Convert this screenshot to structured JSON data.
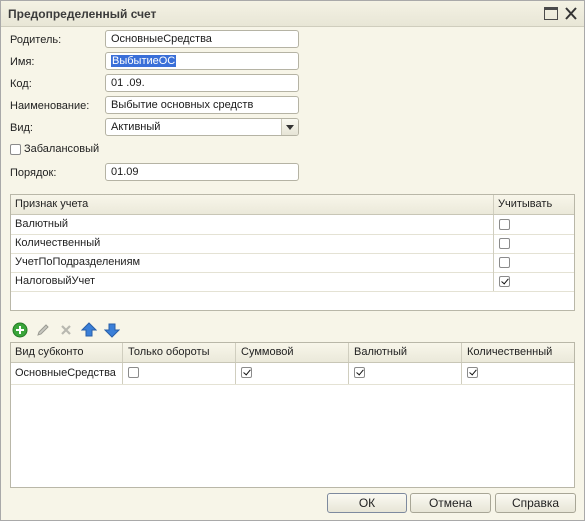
{
  "window": {
    "title": "Предопределенный счет"
  },
  "form": {
    "parent_label": "Родитель:",
    "parent_value": "ОсновныеСредства",
    "name_label": "Имя:",
    "name_value": "ВыбытиеОС",
    "code_label": "Код:",
    "code_value": "01 .09.",
    "description_label": "Наименование:",
    "description_value": "Выбытие основных средств",
    "type_label": "Вид:",
    "type_value": "Активный",
    "offbalance_label": "Забалансовый",
    "offbalance_checked": false,
    "order_label": "Порядок:",
    "order_value": "01.09"
  },
  "features_table": {
    "columns": [
      "Признак учета",
      "Учитывать"
    ],
    "rows": [
      {
        "name": "Валютный",
        "checked": false
      },
      {
        "name": "Количественный",
        "checked": false
      },
      {
        "name": "УчетПоПодразделениям",
        "checked": false
      },
      {
        "name": "НалоговыйУчет",
        "checked": true
      }
    ]
  },
  "toolbar": {
    "icons": [
      "add-icon",
      "edit-icon",
      "delete-icon",
      "move-up-icon",
      "move-down-icon"
    ]
  },
  "subconto_table": {
    "columns": [
      "Вид субконто",
      "Только обороты",
      "Суммовой",
      "Валютный",
      "Количественный"
    ],
    "rows": [
      {
        "name": "ОсновныеСредства",
        "turnover_only": false,
        "sum": true,
        "currency": true,
        "quantity": true
      }
    ]
  },
  "buttons": {
    "ok": "ОК",
    "cancel": "Отмена",
    "help": "Справка"
  },
  "colors": {
    "background": "#f7f5e8",
    "selection": "#3a6fd8",
    "add_green": "#3aa53a",
    "arrow_blue": "#3a7fd8"
  }
}
